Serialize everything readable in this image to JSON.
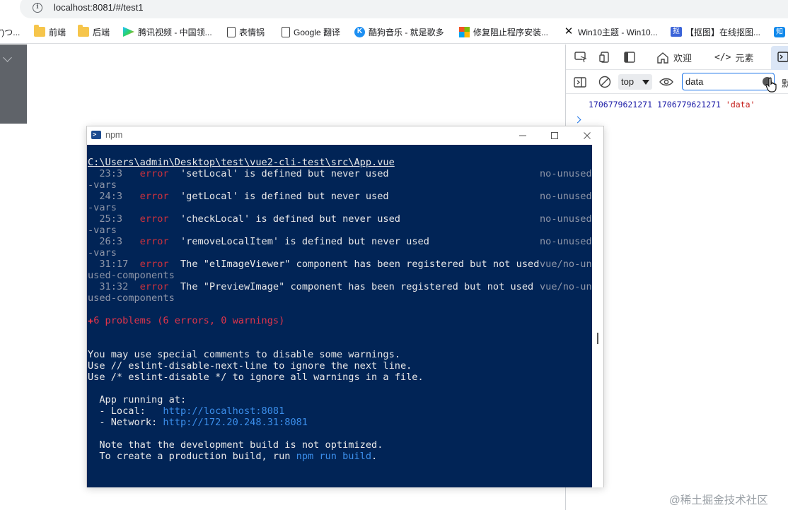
{
  "browser": {
    "url": "localhost:8081/#/test1",
    "bookmarks": [
      {
        "label": "')つ...",
        "icon": "none"
      },
      {
        "label": "前端",
        "icon": "folder-icon"
      },
      {
        "label": "后端",
        "icon": "folder-icon"
      },
      {
        "label": "腾讯视频 - 中国领...",
        "icon": "tencent-video-icon"
      },
      {
        "label": "表情锅",
        "icon": "doc-icon"
      },
      {
        "label": "Google 翻译",
        "icon": "doc-icon"
      },
      {
        "label": "酷狗音乐 - 就是歌多",
        "icon": "kugou-icon"
      },
      {
        "label": "修复阻止程序安装...",
        "icon": "windows-icon"
      },
      {
        "label": "Win10主题 - Win10...",
        "icon": "x-icon"
      },
      {
        "label": "【抠图】在线抠图...",
        "icon": "koutu-icon"
      },
      {
        "label": "知",
        "icon": "zhihu-icon"
      }
    ]
  },
  "devtools": {
    "tabs": {
      "welcome": "欢迎",
      "elements": "元素"
    },
    "context": "top",
    "filter_value": "data",
    "overflow_char": "默",
    "log": {
      "ts1": "1706779621271",
      "ts2": "1706779621271",
      "str": "'data'"
    }
  },
  "terminal": {
    "title": "npm",
    "file_path": "C:\\Users\\admin\\Desktop\\test\\vue2-cli-test\\src\\App.vue",
    "errors": [
      {
        "loc": "  23:3",
        "level": "error",
        "msg": "'setLocal' is defined but never used",
        "rule_a": "no-unused",
        "rule_b": "-vars"
      },
      {
        "loc": "  24:3",
        "level": "error",
        "msg": "'getLocal' is defined but never used",
        "rule_a": "no-unused",
        "rule_b": "-vars"
      },
      {
        "loc": "  25:3",
        "level": "error",
        "msg": "'checkLocal' is defined but never used",
        "rule_a": "no-unused",
        "rule_b": "-vars"
      },
      {
        "loc": "  26:3",
        "level": "error",
        "msg": "'removeLocalItem' is defined but never used",
        "rule_a": "no-unused",
        "rule_b": "-vars"
      },
      {
        "loc": "  31:17",
        "level": "error",
        "msg": "The \"elImageViewer\" component has been registered but not used",
        "rule_a": "vue/no-un",
        "rule_b": "used-components"
      },
      {
        "loc": "  31:32",
        "level": "error",
        "msg": "The \"PreviewImage\" component has been registered but not used",
        "rule_a": "vue/no-un",
        "rule_b": "used-components"
      }
    ],
    "summary_plus": "✚",
    "summary": "6 problems (6 errors, 0 warnings)",
    "hint1": "You may use special comments to disable some warnings.",
    "hint2": "Use // eslint-disable-next-line to ignore the next line.",
    "hint3": "Use /* eslint-disable */ to ignore all warnings in a file.",
    "running": "  App running at:",
    "local_label": "  - Local:   ",
    "local_url": "http://localhost:8081",
    "network_label": "  - Network: ",
    "network_url": "http://172.20.248.31:8081",
    "note1": "  Note that the development build is not optimized.",
    "note2_prefix": "  To create a production build, run ",
    "note2_cmd": "npm run build",
    "note2_suffix": "."
  },
  "watermark": "@稀土掘金技术社区"
}
